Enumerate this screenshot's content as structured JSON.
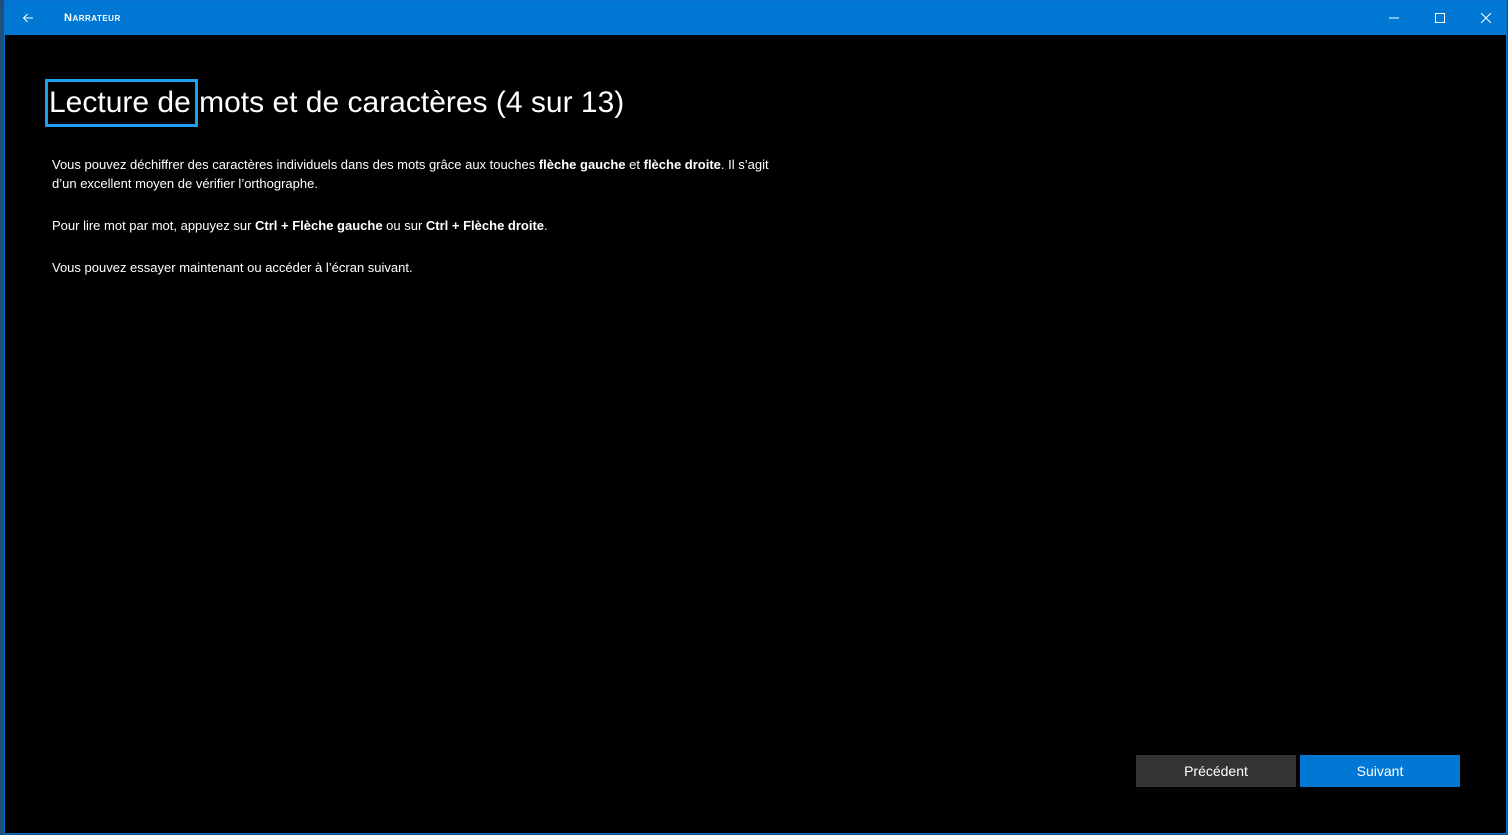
{
  "window": {
    "title": "Narrateur",
    "accent_color": "#0078d4",
    "focus_color": "#1ea0f0"
  },
  "titlebar": {
    "back_icon": "back-arrow-icon",
    "minimize_icon": "minimize-icon",
    "maximize_icon": "maximize-icon",
    "close_icon": "close-icon"
  },
  "page": {
    "heading": "Lecture de mots et de caractères (4 sur 13)",
    "p1_a": "Vous pouvez déchiffrer des caractères individuels dans des mots grâce aux touches ",
    "p1_b1": "flèche gauche",
    "p1_c": " et ",
    "p1_b2": "flèche droite",
    "p1_d": ". Il s’agit d’un excellent moyen de vérifier l’orthographe.",
    "p2_a": "Pour lire mot par mot, appuyez sur ",
    "p2_b1": "Ctrl + Flèche gauche",
    "p2_c": " ou sur ",
    "p2_b2": "Ctrl + Flèche droite",
    "p2_d": ".",
    "p3": "Vous pouvez essayer maintenant ou accéder à l’écran suivant."
  },
  "buttons": {
    "previous": "Précédent",
    "next": "Suivant"
  }
}
